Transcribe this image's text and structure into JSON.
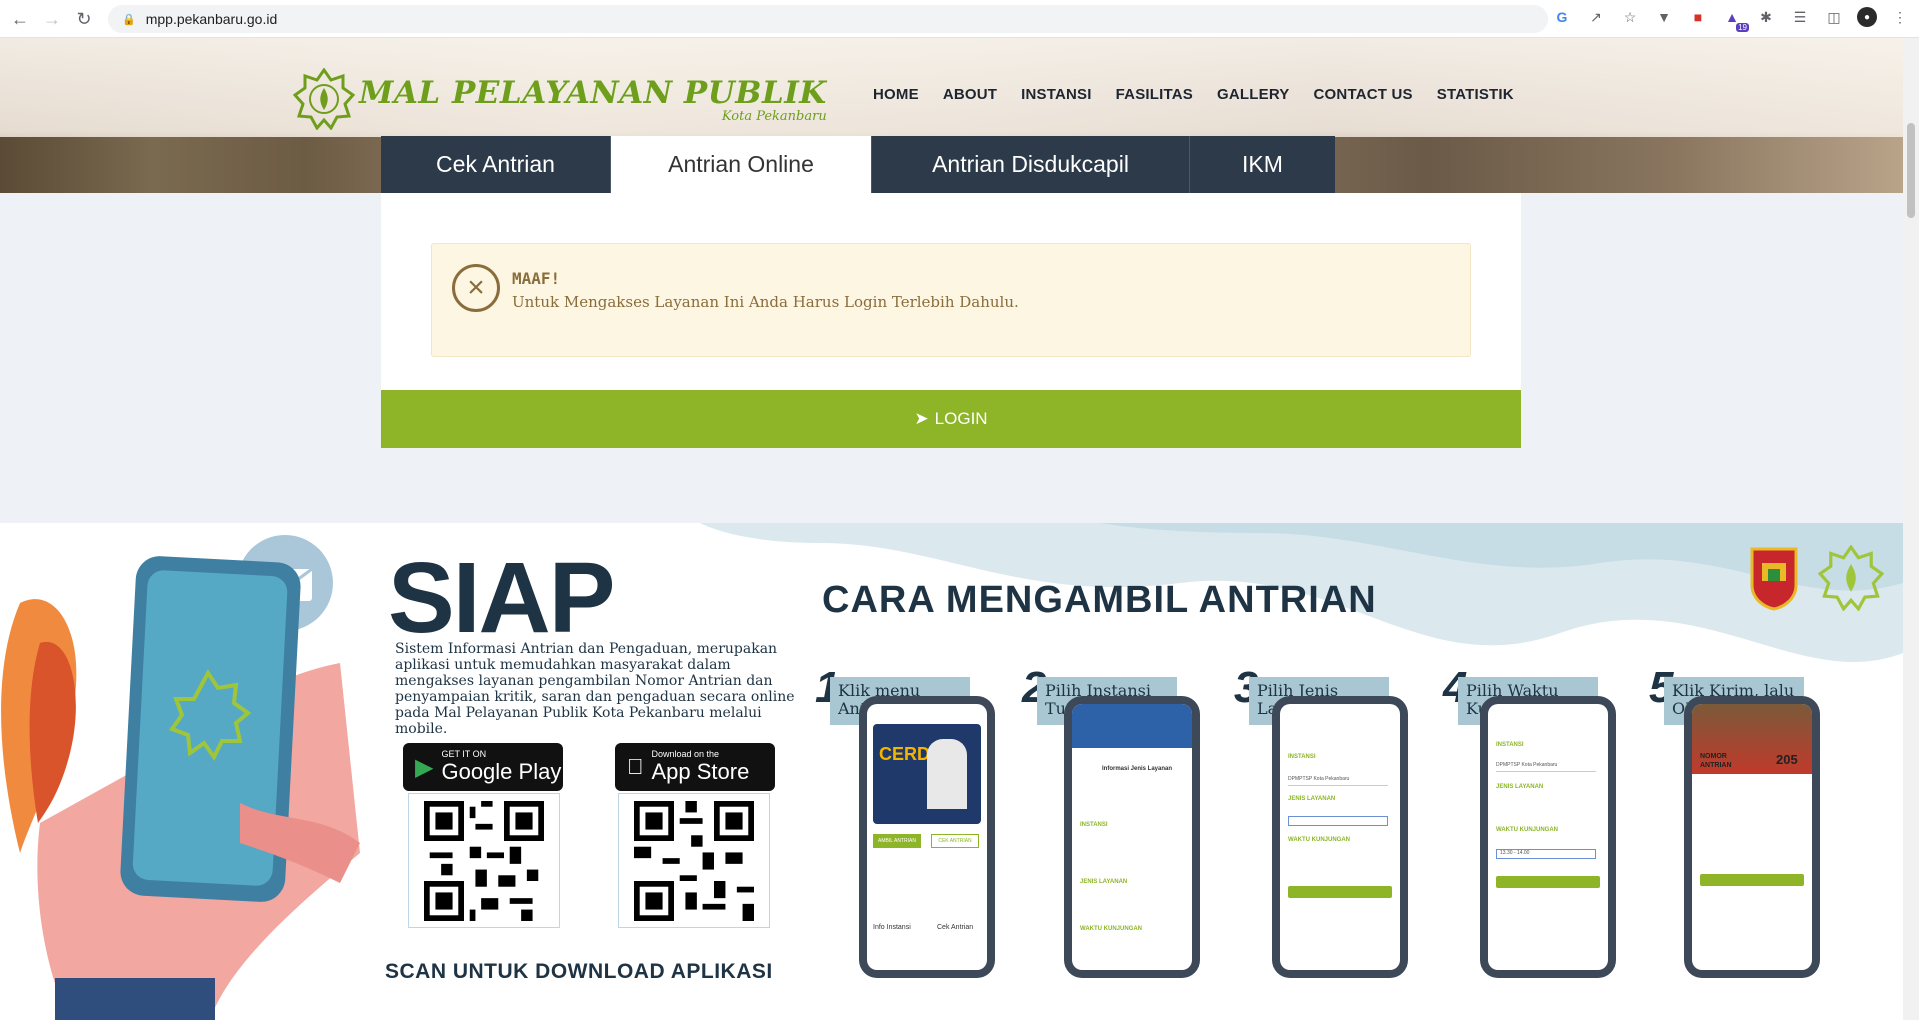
{
  "browser": {
    "url": "mpp.pekanbaru.go.id",
    "extension_badge": "19"
  },
  "header": {
    "logo_title": "MAL PELAYANAN PUBLIK",
    "logo_subtitle": "Kota Pekanbaru",
    "nav": [
      "HOME",
      "ABOUT",
      "INSTANSI",
      "FASILITAS",
      "GALLERY",
      "CONTACT US",
      "STATISTIK"
    ]
  },
  "tabs": [
    {
      "label": "Cek Antrian",
      "active": false
    },
    {
      "label": "Antrian Online",
      "active": true
    },
    {
      "label": "Antrian Disdukcapil",
      "active": false
    },
    {
      "label": "IKM",
      "active": false
    }
  ],
  "alert": {
    "title": "MAAF!",
    "message": "Untuk Mengakses Layanan Ini Anda Harus Login Terlebih Dahulu."
  },
  "login_button": "LOGIN",
  "banner": {
    "app_name": "SIAP",
    "description": "Sistem Informasi Antrian dan Pengaduan, merupakan aplikasi untuk memudahkan masyarakat dalam mengakses layanan pengambilan Nomor Antrian dan penyampaian kritik, saran dan pengaduan secara online pada Mal Pelayanan Publik Kota Pekanbaru melalui mobile.",
    "google_play": {
      "small": "GET IT ON",
      "big": "Google Play"
    },
    "app_store": {
      "small": "Download on the",
      "big": "App Store"
    },
    "scan_text": "SCAN UNTUK DOWNLOAD APLIKASI",
    "heading": "CARA MENGAMBIL ANTRIAN",
    "steps": [
      {
        "number": "1",
        "text": "Klik menu Antrian"
      },
      {
        "number": "2",
        "text": "Pilih Instansi Tujuan"
      },
      {
        "number": "3",
        "text": "Pilih Jenis Layanan"
      },
      {
        "number": "4",
        "text": "Pilih Waktu Kunjungan"
      },
      {
        "number": "5",
        "text": "Klik Kirim, lalu OK"
      }
    ],
    "phone_screens": {
      "s1_title": "CERDAS",
      "s1_btn1": "AMBIL ANTRIAN",
      "s1_btn2": "CEK ANTRIAN",
      "s1_info": "Info Instansi",
      "s1_cek": "Cek Antrian",
      "s2_title": "Informasi Jenis Layanan",
      "s2_instansi": "INSTANSI",
      "s2_jenis": "JENIS LAYANAN",
      "s2_waktu": "WAKTU KUNJUNGAN",
      "s3_instansi": "INSTANSI",
      "s3_value": "DPMPTSP Kota Pekanbaru",
      "s3_jenis": "JENIS LAYANAN",
      "s3_waktu": "WAKTU KUNJUNGAN",
      "s4_instansi": "INSTANSI",
      "s4_value": "DPMPTSP Kota Pekanbaru",
      "s4_jenis": "JENIS LAYANAN",
      "s4_waktu": "WAKTU KUNJUNGAN",
      "s4_time": "13.30 - 14.00",
      "s5_label": "NOMOR ANTRIAN",
      "s5_number": "205"
    }
  },
  "colors": {
    "nav_dark": "#2d3a49",
    "login_green": "#8db527",
    "alert_bg": "#fdf6e3",
    "alert_text": "#8a6d3b",
    "logo_green": "#6f9e1d",
    "banner_navy": "#1e3344"
  }
}
